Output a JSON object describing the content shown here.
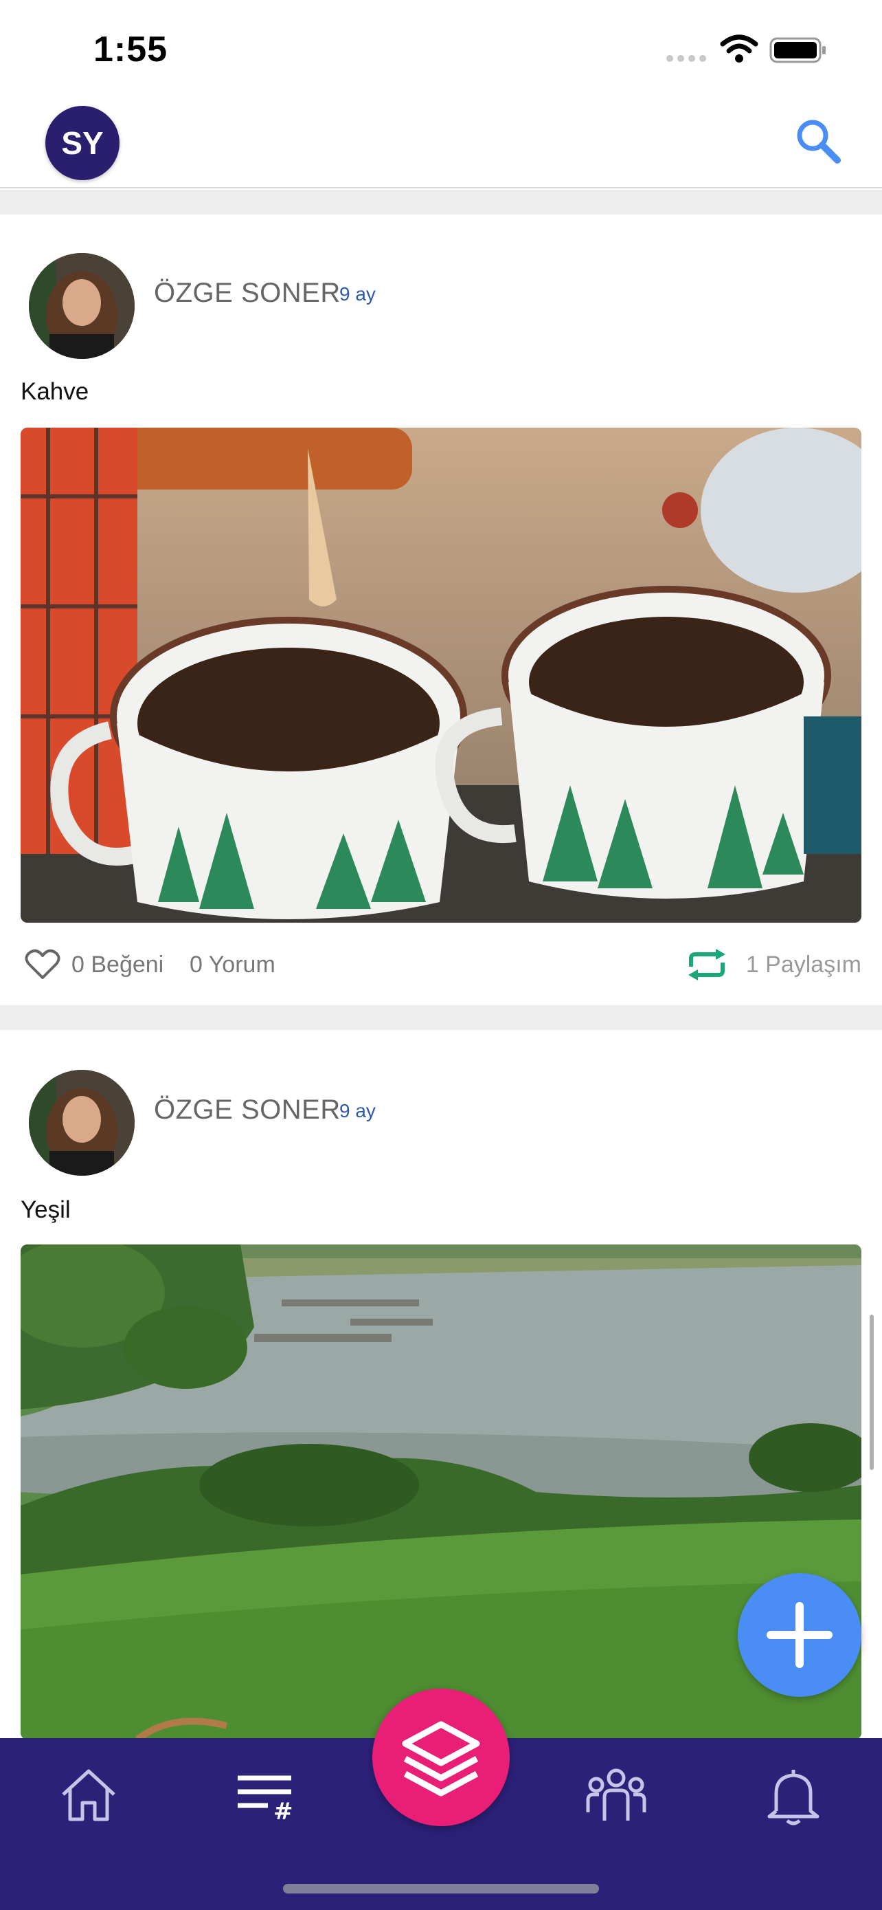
{
  "status_bar": {
    "time": "1:55"
  },
  "header": {
    "user_initials": "SY",
    "search_icon": "search-icon"
  },
  "posts": [
    {
      "author": "ÖZGE SONER",
      "time_ago": "9 ay",
      "text": "Kahve",
      "image_subject": "coffee-mugs-photo",
      "likes": "0 Beğeni",
      "comments": "0 Yorum",
      "shares": "1 Paylaşım"
    },
    {
      "author": "ÖZGE SONER",
      "time_ago": "9 ay",
      "text": "Yeşil",
      "image_subject": "lake-landscape-photo"
    }
  ],
  "bottom_nav": {
    "items": [
      "home-icon",
      "feed-hashtag-icon",
      "layers-icon",
      "groups-icon",
      "bell-icon"
    ],
    "accent_color": "#e91f77",
    "bar_color": "#2c2179"
  },
  "fab": {
    "icon": "plus-icon",
    "color": "#4a8ef5"
  }
}
